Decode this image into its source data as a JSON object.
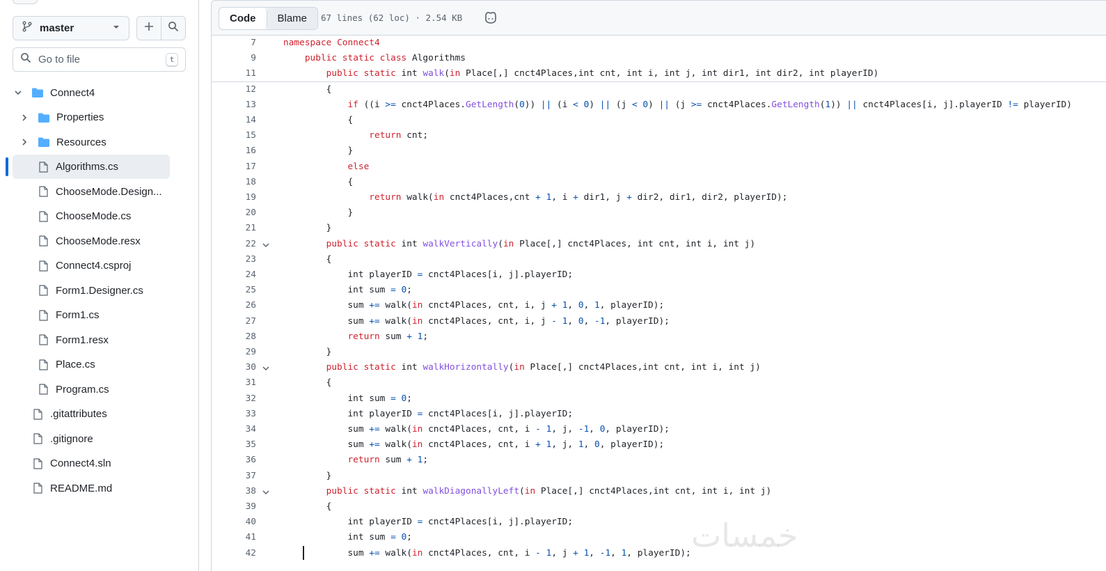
{
  "sidebar": {
    "branch": "master",
    "goto_placeholder": "Go to file",
    "goto_shortcut": "t",
    "tree": [
      {
        "label": "Connect4",
        "type": "folder",
        "expanded": true,
        "level": 0
      },
      {
        "label": "Properties",
        "type": "folder",
        "expanded": false,
        "level": 1
      },
      {
        "label": "Resources",
        "type": "folder",
        "expanded": false,
        "level": 1
      },
      {
        "label": "Algorithms.cs",
        "type": "file",
        "level": 1,
        "selected": true
      },
      {
        "label": "ChooseMode.Design...",
        "type": "file",
        "level": 1
      },
      {
        "label": "ChooseMode.cs",
        "type": "file",
        "level": 1
      },
      {
        "label": "ChooseMode.resx",
        "type": "file",
        "level": 1
      },
      {
        "label": "Connect4.csproj",
        "type": "file",
        "level": 1
      },
      {
        "label": "Form1.Designer.cs",
        "type": "file",
        "level": 1
      },
      {
        "label": "Form1.cs",
        "type": "file",
        "level": 1
      },
      {
        "label": "Form1.resx",
        "type": "file",
        "level": 1
      },
      {
        "label": "Place.cs",
        "type": "file",
        "level": 1
      },
      {
        "label": "Program.cs",
        "type": "file",
        "level": 1
      },
      {
        "label": ".gitattributes",
        "type": "file",
        "level": 0
      },
      {
        "label": ".gitignore",
        "type": "file",
        "level": 0
      },
      {
        "label": "Connect4.sln",
        "type": "file",
        "level": 0
      },
      {
        "label": "README.md",
        "type": "file",
        "level": 0
      }
    ]
  },
  "viewer": {
    "tab_code": "Code",
    "tab_blame": "Blame",
    "file_info": "67 lines (62 loc) · 2.54 KB",
    "copilot_icon": "copilot-icon"
  },
  "code_lines": [
    {
      "n": "7",
      "fold": false,
      "html": "<span class=\"kw\">namespace</span> <span class=\"kw\">Connect4</span>"
    },
    {
      "n": "9",
      "fold": false,
      "html": "    <span class=\"kw\">public</span> <span class=\"kw\">static</span> <span class=\"kw\">class</span> Algorithms"
    },
    {
      "n": "11",
      "fold": false,
      "html": "        <span class=\"kw\">public</span> <span class=\"kw\">static</span> int <span class=\"fn\">walk</span>(<span class=\"kw\">in</span> Place[,] cnct4Places,int cnt, int i, int j, int dir1, int dir2, int playerID)"
    },
    {
      "n": "12",
      "fold": false,
      "html": "        {"
    },
    {
      "n": "13",
      "fold": false,
      "html": "            <span class=\"kw\">if</span> ((i <span class=\"op\">&gt;=</span> cnct4Places.<span class=\"fn\">GetLength</span>(<span class=\"num\">0</span>)) <span class=\"op\">||</span> (i <span class=\"op\">&lt;</span> <span class=\"num\">0</span>) <span class=\"op\">||</span> (j <span class=\"op\">&lt;</span> <span class=\"num\">0</span>) <span class=\"op\">||</span> (j <span class=\"op\">&gt;=</span> cnct4Places.<span class=\"fn\">GetLength</span>(<span class=\"num\">1</span>)) <span class=\"op\">||</span> cnct4Places[i, j].playerID <span class=\"op\">!=</span> playerID)"
    },
    {
      "n": "14",
      "fold": false,
      "html": "            {"
    },
    {
      "n": "15",
      "fold": false,
      "html": "                <span class=\"kw\">return</span> cnt;"
    },
    {
      "n": "16",
      "fold": false,
      "html": "            }"
    },
    {
      "n": "17",
      "fold": false,
      "html": "            <span class=\"kw\">else</span>"
    },
    {
      "n": "18",
      "fold": false,
      "html": "            {"
    },
    {
      "n": "19",
      "fold": false,
      "html": "                <span class=\"kw\">return</span> walk(<span class=\"kw\">in</span> cnct4Places,cnt <span class=\"op\">+</span> <span class=\"num\">1</span>, i <span class=\"op\">+</span> dir1, j <span class=\"op\">+</span> dir2, dir1, dir2, playerID);"
    },
    {
      "n": "20",
      "fold": false,
      "html": "            }"
    },
    {
      "n": "21",
      "fold": false,
      "html": "        }"
    },
    {
      "n": "22",
      "fold": true,
      "html": "        <span class=\"kw\">public</span> <span class=\"kw\">static</span> int <span class=\"fn\">walkVertically</span>(<span class=\"kw\">in</span> Place[,] cnct4Places, int cnt, int i, int j)"
    },
    {
      "n": "23",
      "fold": false,
      "html": "        {"
    },
    {
      "n": "24",
      "fold": false,
      "html": "            int playerID <span class=\"op\">=</span> cnct4Places[i, j].playerID;"
    },
    {
      "n": "25",
      "fold": false,
      "html": "            int sum <span class=\"op\">=</span> <span class=\"num\">0</span>;"
    },
    {
      "n": "26",
      "fold": false,
      "html": "            sum <span class=\"op\">+=</span> walk(<span class=\"kw\">in</span> cnct4Places, cnt, i, j <span class=\"op\">+</span> <span class=\"num\">1</span>, <span class=\"num\">0</span>, <span class=\"num\">1</span>, playerID);"
    },
    {
      "n": "27",
      "fold": false,
      "html": "            sum <span class=\"op\">+=</span> walk(<span class=\"kw\">in</span> cnct4Places, cnt, i, j <span class=\"op\">-</span> <span class=\"num\">1</span>, <span class=\"num\">0</span>, <span class=\"op\">-</span><span class=\"num\">1</span>, playerID);"
    },
    {
      "n": "28",
      "fold": false,
      "html": "            <span class=\"kw\">return</span> sum <span class=\"op\">+</span> <span class=\"num\">1</span>;"
    },
    {
      "n": "29",
      "fold": false,
      "html": "        }"
    },
    {
      "n": "30",
      "fold": true,
      "html": "        <span class=\"kw\">public</span> <span class=\"kw\">static</span> int <span class=\"fn\">walkHorizontally</span>(<span class=\"kw\">in</span> Place[,] cnct4Places,int cnt, int i, int j)"
    },
    {
      "n": "31",
      "fold": false,
      "html": "        {"
    },
    {
      "n": "32",
      "fold": false,
      "html": "            int sum <span class=\"op\">=</span> <span class=\"num\">0</span>;"
    },
    {
      "n": "33",
      "fold": false,
      "html": "            int playerID <span class=\"op\">=</span> cnct4Places[i, j].playerID;"
    },
    {
      "n": "34",
      "fold": false,
      "html": "            sum <span class=\"op\">+=</span> walk(<span class=\"kw\">in</span> cnct4Places, cnt, i <span class=\"op\">-</span> <span class=\"num\">1</span>, j, <span class=\"op\">-</span><span class=\"num\">1</span>, <span class=\"num\">0</span>, playerID);"
    },
    {
      "n": "35",
      "fold": false,
      "html": "            sum <span class=\"op\">+=</span> walk(<span class=\"kw\">in</span> cnct4Places, cnt, i <span class=\"op\">+</span> <span class=\"num\">1</span>, j, <span class=\"num\">1</span>, <span class=\"num\">0</span>, playerID);"
    },
    {
      "n": "36",
      "fold": false,
      "html": "            <span class=\"kw\">return</span> sum <span class=\"op\">+</span> <span class=\"num\">1</span>;"
    },
    {
      "n": "37",
      "fold": false,
      "html": "        }"
    },
    {
      "n": "38",
      "fold": true,
      "html": "        <span class=\"kw\">public</span> <span class=\"kw\">static</span> int <span class=\"fn\">walkDiagonallyLeft</span>(<span class=\"kw\">in</span> Place[,] cnct4Places,int cnt, int i, int j)"
    },
    {
      "n": "39",
      "fold": false,
      "html": "        {"
    },
    {
      "n": "40",
      "fold": false,
      "html": "            int playerID <span class=\"op\">=</span> cnct4Places[i, j].playerID;"
    },
    {
      "n": "41",
      "fold": false,
      "html": "            int sum <span class=\"op\">=</span> <span class=\"num\">0</span>;"
    },
    {
      "n": "42",
      "fold": false,
      "html": "            sum <span class=\"op\">+=</span> walk(<span class=\"kw\">in</span> cnct4Places, cnt, i <span class=\"op\">-</span> <span class=\"num\">1</span>, j <span class=\"op\">+</span> <span class=\"num\">1</span>, <span class=\"op\">-</span><span class=\"num\">1</span>, <span class=\"num\">1</span>, playerID);"
    }
  ],
  "watermark": "خمسات",
  "colors": {
    "accent": "#0969da",
    "keyword": "#cf222e",
    "function": "#8250df",
    "number": "#0550ae"
  }
}
